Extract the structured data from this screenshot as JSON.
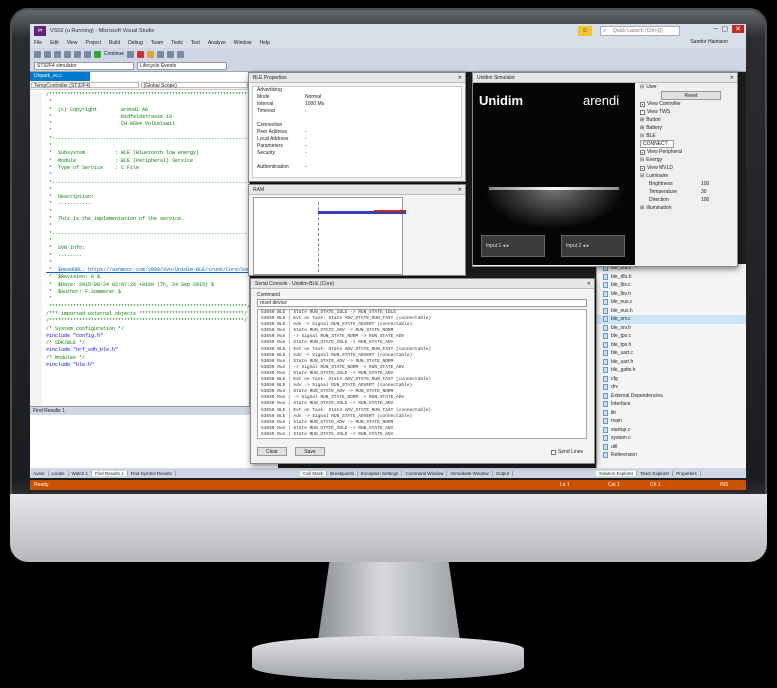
{
  "app": {
    "title": "VS02 (u Running) - Microsoft Visual Studio",
    "search_placeholder": "Quick Launch (Ctrl+Q)",
    "user": "Sandor Haimann"
  },
  "menu": [
    "File",
    "Edit",
    "View",
    "Project",
    "Build",
    "Debug",
    "Team",
    "Tools",
    "Test",
    "Analyze",
    "Window",
    "Help"
  ],
  "toolbar": {
    "platform": "ST32F4 simulator",
    "continue": "Continue",
    "frame": "Lifecycle Events"
  },
  "editor": {
    "tab": "Unpark_vc.c",
    "nav_left": "TempController (ST32F4)",
    "nav_right": "(Global Scope)",
    "lines": [
      {
        "c": "/*******************************************************************",
        "t": "g"
      },
      {
        "c": " *",
        "t": "g"
      },
      {
        "c": " *  (c) Copyright        arendi AG",
        "t": "g"
      },
      {
        "c": " *                       Nidfeldstrasse 10",
        "t": "g"
      },
      {
        "c": " *                       CH-8604 Volketswil",
        "t": "g"
      },
      {
        "c": " *",
        "t": "g"
      },
      {
        "c": " *-------------------------------------------------------------------",
        "t": "g"
      },
      {
        "c": " *",
        "t": "g"
      },
      {
        "c": " *  Subsystem          : BLE (Bluetooth low energy)",
        "t": "g"
      },
      {
        "c": " *  Module             : BLE (Peripheral) Service",
        "t": "g"
      },
      {
        "c": " *  Type of Service    : C File",
        "t": "g"
      },
      {
        "c": " *",
        "t": "g"
      },
      {
        "c": " *-------------------------------------------------------------------",
        "t": "g"
      },
      {
        "c": " *",
        "t": "g"
      },
      {
        "c": " *  Description:",
        "t": "g"
      },
      {
        "c": " *  -----------",
        "t": "g"
      },
      {
        "c": " *",
        "t": "g"
      },
      {
        "c": " *  This is the implementation of the service.",
        "t": "g"
      },
      {
        "c": " *",
        "t": "g"
      },
      {
        "c": " *-------------------------------------------------------------------",
        "t": "g"
      },
      {
        "c": " *",
        "t": "g"
      },
      {
        "c": " *  SVN Info:",
        "t": "g"
      },
      {
        "c": " *  --------",
        "t": "g"
      },
      {
        "c": " *",
        "t": "g"
      },
      {
        "c": " *  $HeadURL: https://ashmoor.com:3000/svn/Unidim-BLE/trunk/Core/Source",
        "t": "k"
      },
      {
        "c": " *  $Revision: 0 $",
        "t": "g"
      },
      {
        "c": " *  $Date: 2015-09-24 02:07:26 +0100 (Th, 24 Sep 2015) $",
        "t": "g"
      },
      {
        "c": " *  $Author: F.Sommerer $",
        "t": "g"
      },
      {
        "c": " *",
        "t": "g"
      },
      {
        "c": " ******************************************************************/",
        "t": "g"
      },
      {
        "c": "",
        "t": "g"
      },
      {
        "c": "",
        "t": "g"
      },
      {
        "c": "/*** imported external objects ***********************************/",
        "t": "g"
      },
      {
        "c": "/*****************************************************************/",
        "t": "g"
      },
      {
        "c": "",
        "t": "g"
      },
      {
        "c": "/* System configuration */",
        "t": "g"
      },
      {
        "c": "#include \"config.h\"",
        "t": "b"
      },
      {
        "c": "",
        "t": "g"
      },
      {
        "c": "/* SDK/BLE */",
        "t": "g"
      },
      {
        "c": "#include \"nrf_sdh_ble.h\"",
        "t": "b"
      },
      {
        "c": "",
        "t": "g"
      },
      {
        "c": "/* Modules */",
        "t": "g"
      },
      {
        "c": "#include \"ble.h\"",
        "t": "b"
      }
    ]
  },
  "find_results": {
    "title": "Find Results 1"
  },
  "bottom_tabs": [
    "Autos",
    "Locals",
    "Watch 1",
    "Find Results 1",
    "Find Symbol Results"
  ],
  "bottom_tabs_right": [
    "Call Stack",
    "Breakpoints",
    "Exception Settings",
    "Command Window",
    "Immediate Window",
    "Output"
  ],
  "solution_tabs": [
    "Solution Explorer",
    "Team Explorer",
    "Properties"
  ],
  "status": {
    "left": "Ready",
    "ln": "Ln 1",
    "col": "Col 1",
    "ch": "Ch 1",
    "ins": "INS"
  },
  "solution": {
    "items": [
      {
        "n": "ble_dfu.c",
        "sel": false
      },
      {
        "n": "ble_dfu.h",
        "sel": false
      },
      {
        "n": "ble_lbs.c",
        "sel": false
      },
      {
        "n": "ble_lbs.h",
        "sel": false
      },
      {
        "n": "ble_nus.c",
        "sel": false
      },
      {
        "n": "ble_nus.h",
        "sel": false
      },
      {
        "n": "ble_srv.c",
        "sel": true
      },
      {
        "n": "ble_srv.h",
        "sel": false
      },
      {
        "n": "ble_tps.c",
        "sel": false
      },
      {
        "n": "ble_tps.h",
        "sel": false
      },
      {
        "n": "ble_uart.c",
        "sel": false
      },
      {
        "n": "ble_uart.h",
        "sel": false
      },
      {
        "n": "ble_gatts.h",
        "sel": false
      },
      {
        "n": "cfg",
        "sel": false
      },
      {
        "n": "drv",
        "sel": false
      },
      {
        "n": "External Dependencies",
        "sel": false
      },
      {
        "n": "Interface",
        "sel": false
      },
      {
        "n": "lib",
        "sel": false
      },
      {
        "n": "main",
        "sel": false
      },
      {
        "n": "startup.c",
        "sel": false
      },
      {
        "n": "system.c",
        "sel": false
      },
      {
        "n": "util",
        "sel": false
      },
      {
        "n": "Referenzen",
        "sel": false
      }
    ]
  },
  "ble_window": {
    "title": "BLE Properties",
    "rows": [
      {
        "k": "Advertising",
        "v": ""
      },
      {
        "k": "Mode",
        "v": "Normal"
      },
      {
        "k": "Interval",
        "v": "1000 Ms"
      },
      {
        "k": "Timeout",
        "v": "-"
      },
      {
        "k": "",
        "v": ""
      },
      {
        "k": "Connection",
        "v": ""
      },
      {
        "k": "Peer Address",
        "v": "-"
      },
      {
        "k": "Local Address",
        "v": "-"
      },
      {
        "k": "Parameters",
        "v": "-"
      },
      {
        "k": "Security",
        "v": "-"
      },
      {
        "k": "",
        "v": ""
      },
      {
        "k": "Authentication",
        "v": "-"
      }
    ]
  },
  "ram_window": {
    "title": "RAM"
  },
  "terminal": {
    "title": "Serial Console - Unidim-BLE (Core)",
    "group_label": "Command",
    "command": "reset device",
    "lines": [
      "53650 BLE | State RUN_STATE_IDLE -> RUN_STATE_IDLE",
      "53650 BLE | Evt on Task: State ADV_STATE_RUN_FAST (connectable)",
      "53650 BLE | Adv -> Signal RUN_STATE_ADVERT (connectable)",
      "53650 Run | State RUN_STATE_ADV -> RUN_STATE_NORM",
      "53650 Run | -> Signal RUN_STATE_NORM -> RUN_STATE_ADV",
      "53650 Run | State RUN_STATE_IDLE -> RUN_STATE_ADV",
      "53650 BLE | Evt on Task: State ADV_STATE_RUN_FAST (connectable)",
      "53650 BLE | Adv -> Signal RUN_STATE_ADVERT (connectable)",
      "53650 Run | State RUN_STATE_ADV -> RUN_STATE_NORM",
      "53650 Run | -> Signal RUN_STATE_NORM -> RUN_STATE_ADV",
      "53650 Run | State RUN_STATE_IDLE -> RUN_STATE_ADV",
      "53650 BLE | Evt on Task: State ADV_STATE_RUN_FAST (connectable)",
      "53650 BLE | Adv -> Signal RUN_STATE_ADVERT (connectable)",
      "53650 Run | State RUN_STATE_ADV -> RUN_STATE_NORM",
      "53650 Run | -> Signal RUN_STATE_NORM -> RUN_STATE_ADV",
      "53650 Run | State RUN_STATE_IDLE -> RUN_STATE_ADV",
      "53650 BLE | Evt on Task: State ADV_STATE_RUN_FAST (connectable)",
      "53650 BLE | Adv -> Signal RUN_STATE_ADVERT (connectable)",
      "53650 Run | State RUN_STATE_ADV -> RUN_STATE_NORM",
      "53650 Run | State RUN_STATE_IDLE -> RUN_STATE_ADV",
      "53650 Run | State RUN_STATE_IDLE -> RUN_STATE_ADV"
    ],
    "clear": "Clear",
    "save": "Save",
    "send_label": "Send Lines"
  },
  "simulator": {
    "title": "Unidim Simulator",
    "brand_left": "Unidim",
    "brand_right": "arendi",
    "input1": "Input 1",
    "input2": "Input 2",
    "side": {
      "user_label": "User",
      "reset": "Reset",
      "opts": [
        "View Controller",
        "View TWS"
      ],
      "sections": [
        "Button",
        "Battery",
        "BLE"
      ],
      "ble_mode": "CONNECT",
      "view_peripheral": "View Peripheral",
      "energy": "Energy",
      "view_mvld": "View MVLD",
      "luminaire": "Luminaire",
      "readouts": [
        {
          "k": "Brightness",
          "v": "100"
        },
        {
          "k": "Temperature",
          "v": "30"
        },
        {
          "k": "Direction",
          "v": "100"
        }
      ],
      "illumination": "Illumination"
    }
  },
  "colors": {
    "accent": "#007acc",
    "status": "#ca5100",
    "ram_series": "#3a3fb8",
    "ram_alloc": "#c62828"
  }
}
